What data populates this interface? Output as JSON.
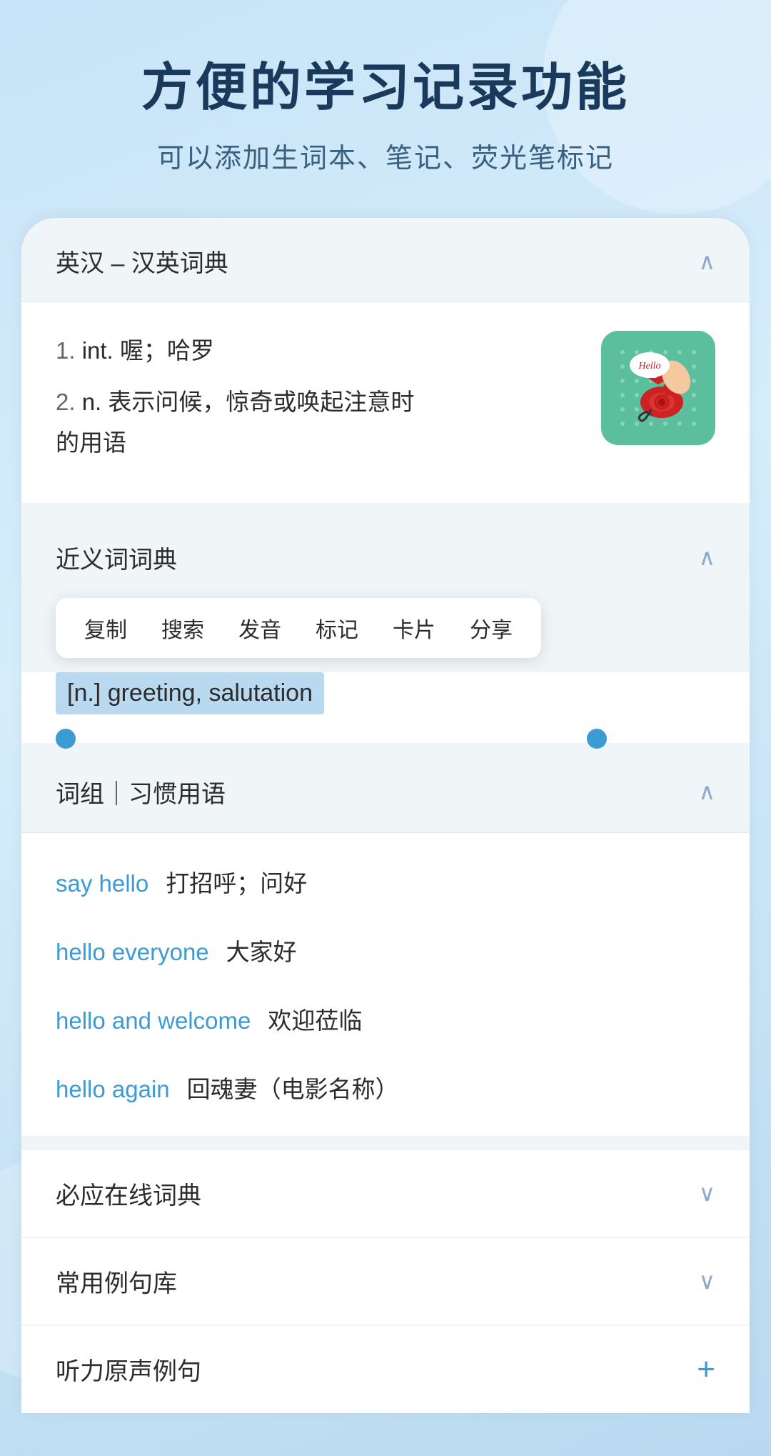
{
  "header": {
    "title": "方便的学习记录功能",
    "subtitle": "可以添加生词本、笔记、荧光笔标记"
  },
  "english_chinese_dict": {
    "section_title": "英汉 – 汉英词典",
    "definitions": [
      {
        "number": "1.",
        "part_of_speech": "int.",
        "meaning": "喔；哈罗"
      },
      {
        "number": "2.",
        "part_of_speech": "n.",
        "meaning": "表示问候，惊奇或唤起注意时的用语"
      }
    ],
    "image_alt": "Hello telephone illustration"
  },
  "synonyms_dict": {
    "section_title": "近义词词典",
    "context_menu_items": [
      "复制",
      "搜索",
      "发音",
      "标记",
      "卡片",
      "分享"
    ],
    "selected_text": "[n.] greeting, salutation"
  },
  "phrases_section": {
    "section_title": "词组｜习惯用语",
    "phrases": [
      {
        "english": "say hello",
        "chinese": "打招呼；问好"
      },
      {
        "english": "hello everyone",
        "chinese": "大家好"
      },
      {
        "english": "hello and welcome",
        "chinese": "欢迎莅临"
      },
      {
        "english": "hello again",
        "chinese": "回魂妻（电影名称）"
      }
    ]
  },
  "bottom_sections": [
    {
      "title": "必应在线词典",
      "icon": "chevron-down"
    },
    {
      "title": "常用例句库",
      "icon": "chevron-down"
    },
    {
      "title": "听力原声例句",
      "icon": "plus"
    }
  ],
  "colors": {
    "accent_blue": "#3a9bd5",
    "dark_navy": "#1a3a5c",
    "background": "#c8e4f8",
    "card_bg": "#ffffff",
    "section_bg": "#f0f5f8"
  }
}
